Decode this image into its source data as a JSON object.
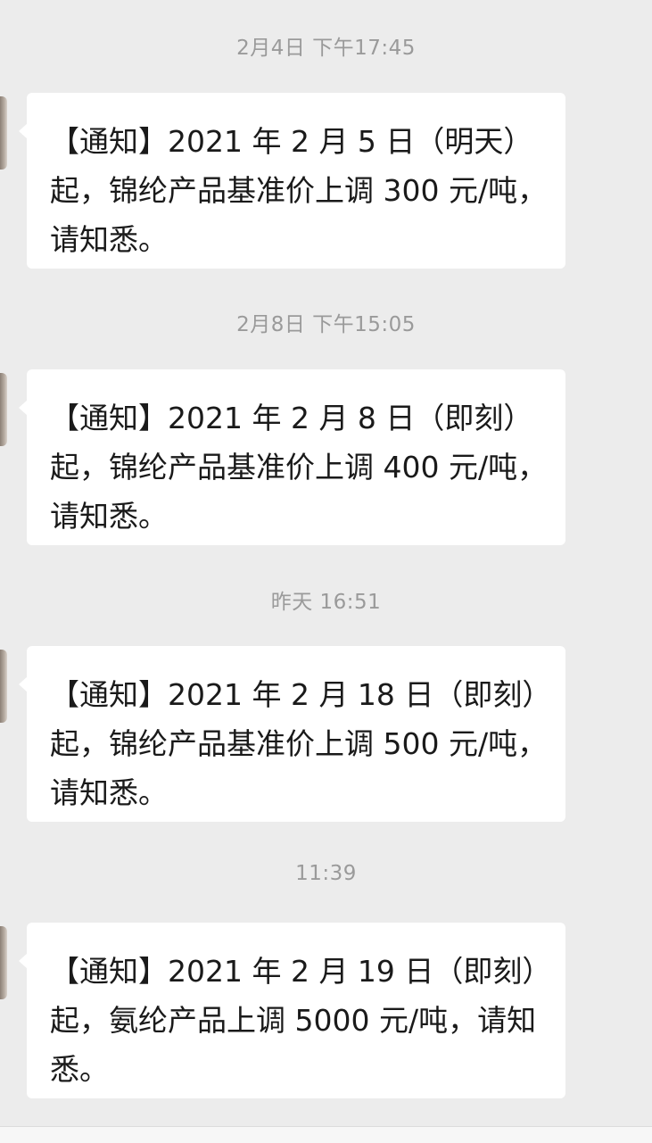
{
  "messages": [
    {
      "timestamp": "2月4日 下午17:45",
      "text": "【通知】2021 年 2 月 5 日（明天）起，锦纶产品基准价上调 300 元/吨，请知悉。"
    },
    {
      "timestamp": "2月8日 下午15:05",
      "text": "【通知】2021 年 2 月 8 日（即刻）起，锦纶产品基准价上调 400 元/吨，请知悉。"
    },
    {
      "timestamp": "昨天 16:51",
      "text": "【通知】2021 年 2 月 18 日（即刻）起，锦纶产品基准价上调 500 元/吨，请知悉。"
    },
    {
      "timestamp": "11:39",
      "text": "【通知】2021 年 2 月 19 日（即刻）起，氨纶产品上调 5000 元/吨，请知悉。"
    }
  ]
}
